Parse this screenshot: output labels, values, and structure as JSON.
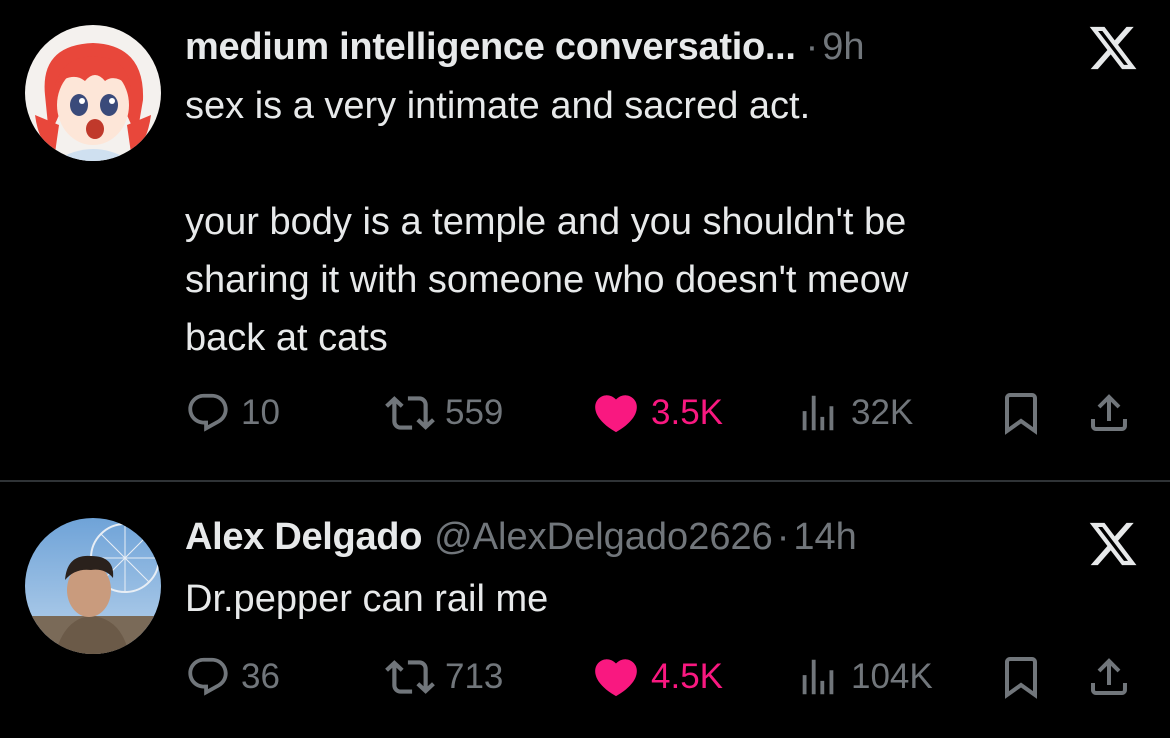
{
  "tweets": [
    {
      "display_name": "medium intelligence conversatio...",
      "handle": "",
      "separator": "·",
      "time": "9h",
      "text": "sex is a very intimate and sacred act.\n\nyour body is a temple and you shouldn't be\nsharing it with someone who doesn't meow\nback at cats",
      "replies": "10",
      "retweets": "559",
      "likes": "3.5K",
      "views": "32K",
      "liked": true
    },
    {
      "display_name": "Alex Delgado",
      "handle": "@AlexDelgado2626",
      "separator": "·",
      "time": "14h",
      "text": "Dr.pepper can rail me",
      "replies": "36",
      "retweets": "713",
      "likes": "4.5K",
      "views": "104K",
      "liked": true
    }
  ],
  "icons": {
    "brand": "x-logo-icon",
    "reply": "reply-icon",
    "retweet": "retweet-icon",
    "like": "heart-icon",
    "views": "views-icon",
    "bookmark": "bookmark-icon",
    "share": "share-icon"
  },
  "colors": {
    "background": "#000000",
    "text": "#e7e9ea",
    "secondary": "#71767b",
    "like": "#f91880",
    "divider": "#2f3336"
  }
}
